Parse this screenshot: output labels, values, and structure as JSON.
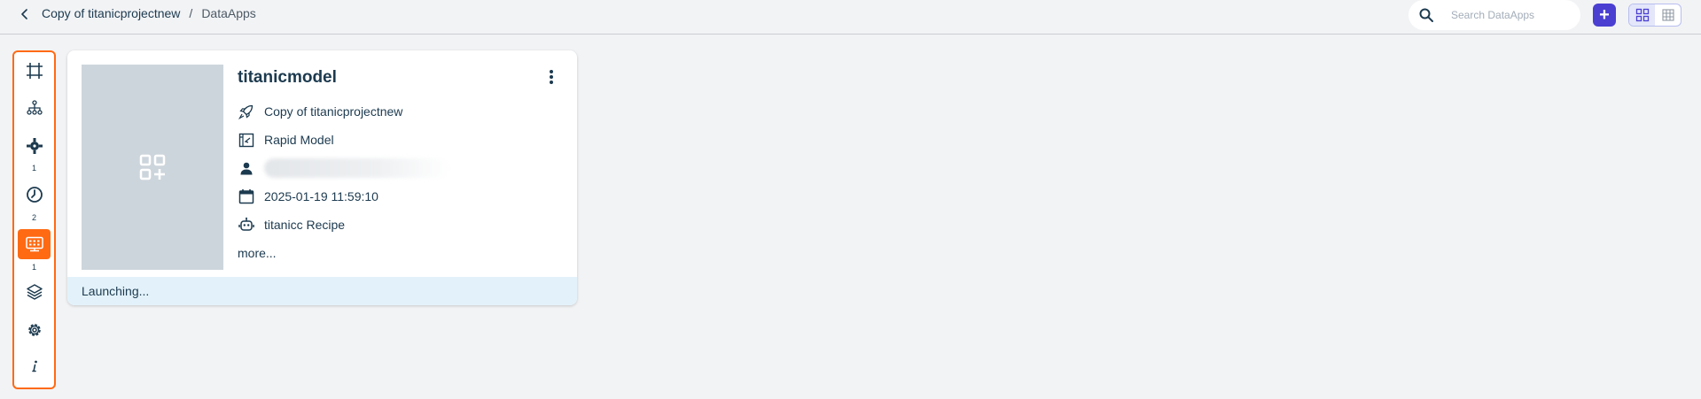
{
  "header": {
    "breadcrumb_project": "Copy of titanicprojectnew",
    "breadcrumb_separator": "/",
    "breadcrumb_current": "DataApps"
  },
  "search": {
    "placeholder": "Search DataApps",
    "value": ""
  },
  "add_button": {
    "label": "+"
  },
  "view_toggle": {
    "options": [
      "grid-view",
      "table-view"
    ],
    "selected": "grid-view"
  },
  "sidebar": {
    "accent_color": "#ff6a13",
    "items": [
      {
        "id": "canvas",
        "icon": "canvas-icon",
        "count": ""
      },
      {
        "id": "dag",
        "icon": "hierarchy-icon",
        "count": ""
      },
      {
        "id": "predictions",
        "icon": "gear-bot-icon",
        "count": "1"
      },
      {
        "id": "jobs",
        "icon": "clock-icon",
        "count": "2"
      },
      {
        "id": "dataapps",
        "icon": "dashboard-icon",
        "count": "1",
        "active": true
      },
      {
        "id": "artifacts",
        "icon": "layers-icon",
        "count": ""
      },
      {
        "id": "settings",
        "icon": "gear-icon",
        "count": ""
      },
      {
        "id": "info",
        "icon": "info-icon",
        "count": ""
      }
    ]
  },
  "card": {
    "title": "titanicmodel",
    "project": "Copy of titanicprojectnew",
    "model_type": "Rapid Model",
    "created_by": "",
    "created_at": "2025-01-19 11:59:10",
    "recipe": "titanicc Recipe",
    "more_label": "more...",
    "status": "Launching..."
  },
  "colors": {
    "primary": "#4a3fd1",
    "text": "#1c3a4f",
    "status_bg": "#e3f2fa",
    "thumbnail_bg": "#cdd5dc"
  }
}
